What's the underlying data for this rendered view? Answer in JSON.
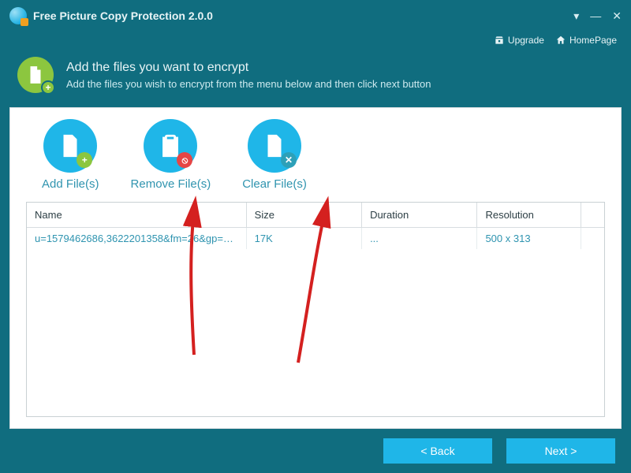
{
  "window": {
    "title": "Free Picture Copy Protection 2.0.0"
  },
  "toolbar": {
    "upgrade": "Upgrade",
    "homepage": "HomePage"
  },
  "header": {
    "title": "Add the files you want to encrypt",
    "subtitle": "Add the files you wish to encrypt from the menu below and then click next button"
  },
  "actions": {
    "add": "Add File(s)",
    "remove": "Remove File(s)",
    "clear": "Clear File(s)"
  },
  "table": {
    "columns": {
      "name": "Name",
      "size": "Size",
      "duration": "Duration",
      "resolution": "Resolution"
    },
    "rows": [
      {
        "name": "u=1579462686,3622201358&fm=26&gp=0....",
        "size": "17K",
        "duration": "...",
        "resolution": "500 x 313"
      }
    ]
  },
  "footer": {
    "back": "<  Back",
    "next": "Next  >"
  }
}
